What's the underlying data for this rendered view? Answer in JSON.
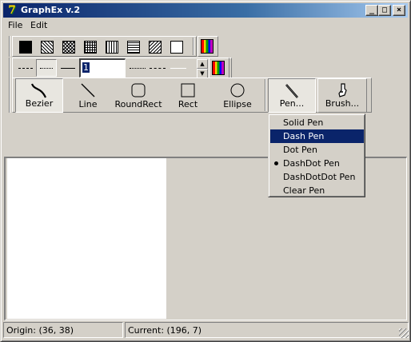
{
  "window": {
    "title": "GraphEx v.2",
    "icon": "graphex-app-icon"
  },
  "title_buttons": [
    {
      "name": "minimize-button",
      "glyph": "_"
    },
    {
      "name": "maximize-button",
      "glyph": "□"
    },
    {
      "name": "close-button",
      "glyph": "×"
    }
  ],
  "menu": {
    "file": "File",
    "edit": "Edit"
  },
  "brush_styles": [
    "solid",
    "diagonal-cross",
    "cross-hatch",
    "grid",
    "vertical",
    "horizontal",
    "diagonal",
    "clear"
  ],
  "pen_width": {
    "value": "1"
  },
  "tools": {
    "bezier": "Bezier",
    "line": "Line",
    "roundrect": "RoundRect",
    "rect": "Rect",
    "ellipse": "Ellipse",
    "pen": "Pen...",
    "brush": "Brush..."
  },
  "pen_menu": {
    "items": [
      "Solid Pen",
      "Dash Pen",
      "Dot Pen",
      "DashDot Pen",
      "DashDotDot Pen",
      "Clear Pen"
    ],
    "highlighted": "Dash Pen",
    "checked": "DashDot Pen"
  },
  "status": {
    "origin": "Origin: (36, 38)",
    "current": "Current: (196, 7)"
  },
  "colors": {
    "title_start": "#0a246a",
    "title_end": "#a6caf0",
    "face": "#d4d0c8",
    "highlight": "#0a246a"
  }
}
